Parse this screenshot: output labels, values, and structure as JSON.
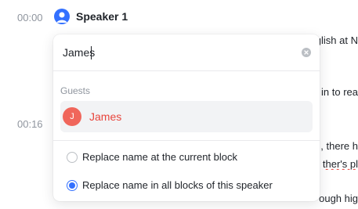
{
  "transcript": {
    "blocks": [
      {
        "timestamp": "00:00",
        "speaker": "Speaker 1"
      },
      {
        "timestamp": "00:16"
      }
    ],
    "background_lines": [
      "glish at N",
      "in to rea",
      ", there h",
      "ther's pl",
      "ough hig"
    ]
  },
  "rename_popup": {
    "search": {
      "value": "James"
    },
    "section_label": "Guests",
    "guests": [
      {
        "initial": "J",
        "name": "James"
      }
    ],
    "options": [
      {
        "label": "Replace name at the current block",
        "selected": false
      },
      {
        "label": "Replace name in all blocks of this speaker",
        "selected": true
      }
    ]
  },
  "colors": {
    "accent": "#3370ff",
    "guest_avatar": "#f0665b",
    "guest_name": "#e8453c",
    "muted": "#8f959e"
  }
}
